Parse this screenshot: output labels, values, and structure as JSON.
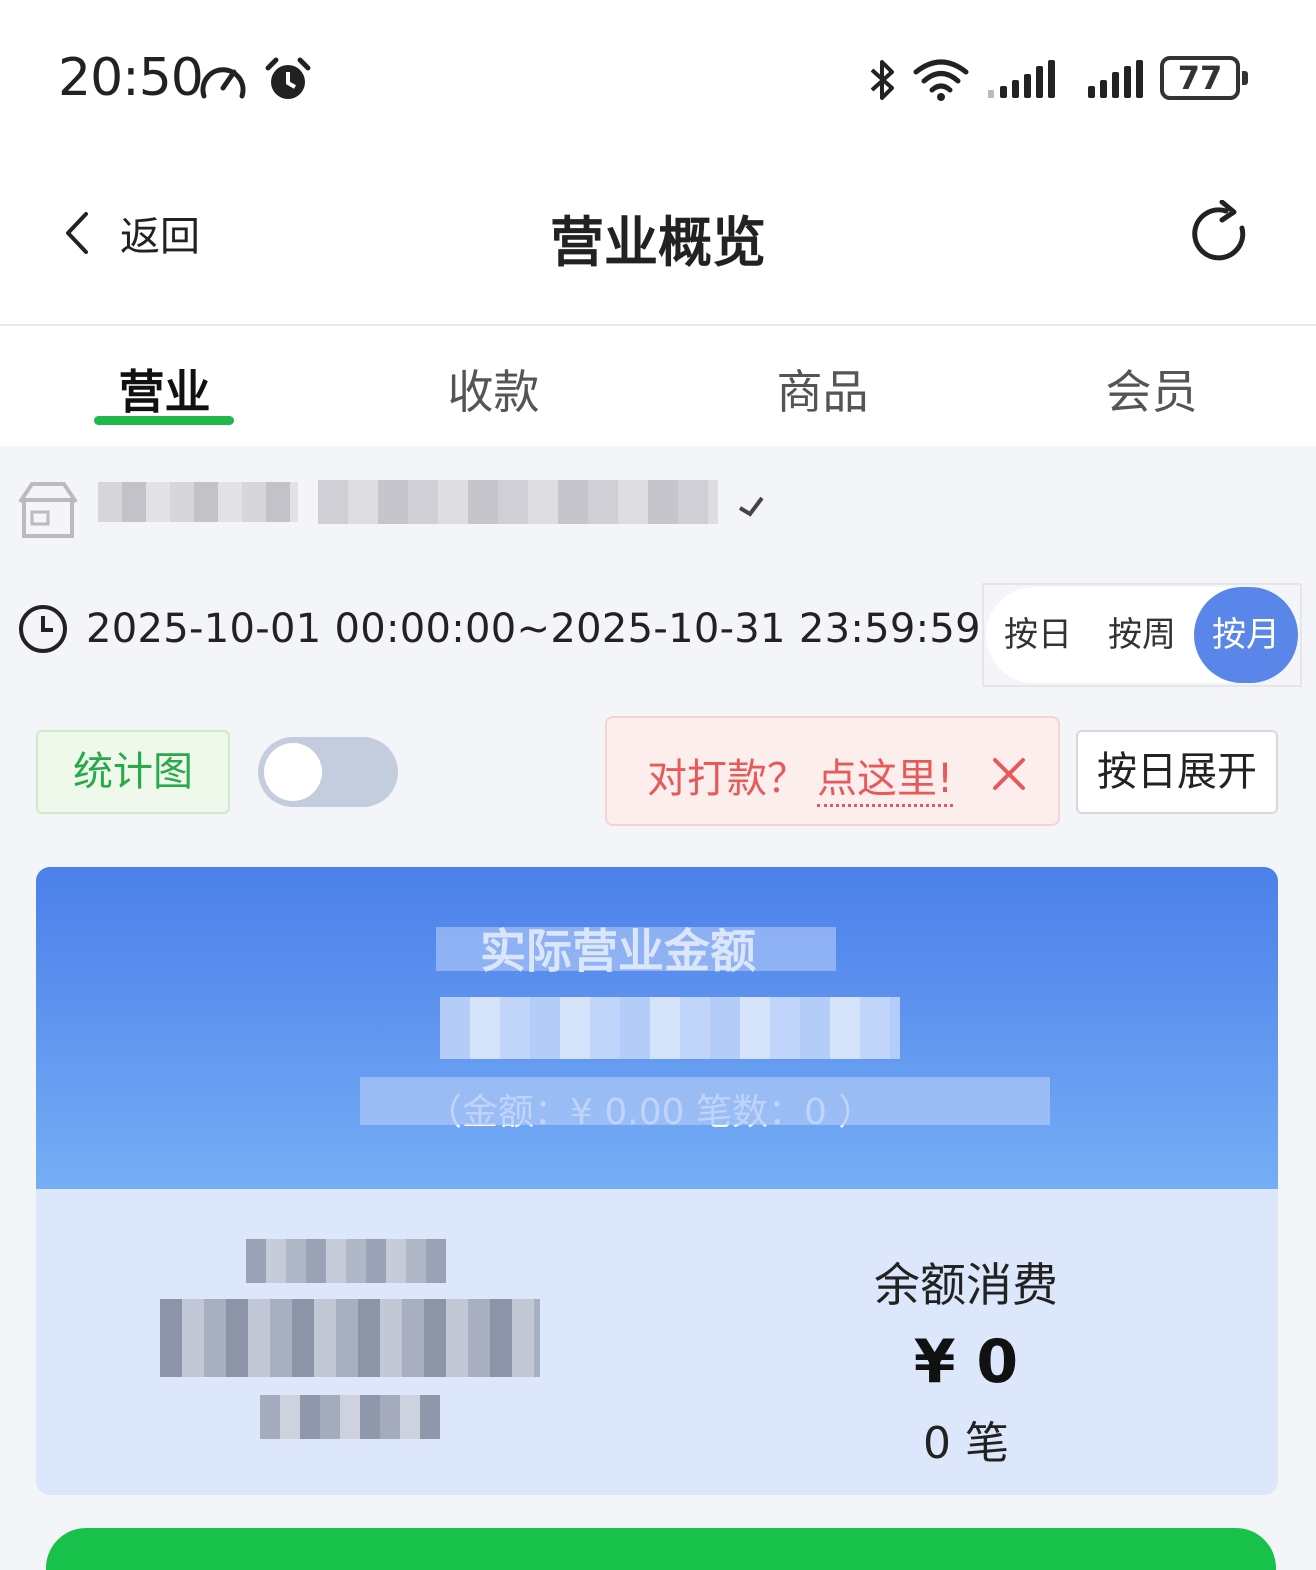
{
  "status_bar": {
    "time": "20:50",
    "battery": "77",
    "icons": [
      "speedometer-icon",
      "alarm-icon",
      "bluetooth-icon",
      "wifi-icon",
      "signal-icon",
      "signal-icon"
    ]
  },
  "nav": {
    "back_label": "返回",
    "title": "营业概览"
  },
  "tabs": [
    {
      "label": "营业",
      "active": true
    },
    {
      "label": "收款",
      "active": false
    },
    {
      "label": "商品",
      "active": false
    },
    {
      "label": "会员",
      "active": false
    }
  ],
  "date_range": "2025-10-01 00:00:00~2025-10-31 23:59:59",
  "period_toggle": {
    "options": [
      "按日",
      "按周",
      "按月"
    ],
    "selected": "按月"
  },
  "controls": {
    "chart_label": "统计图",
    "chart_switch_on": false,
    "notice_question": "对打款？",
    "notice_link": "点这里!",
    "expand_label": "按日展开"
  },
  "summary": {
    "title": "实际营业金额",
    "sub": "（金额：¥ 0.00   笔数：0 ）",
    "balance_label": "余额消费",
    "balance_value": "¥ 0",
    "balance_count": "0 笔"
  },
  "colors": {
    "accent_green": "#1fb84a",
    "active_blue": "#5a86ea",
    "notice_red": "#e85a5a"
  }
}
